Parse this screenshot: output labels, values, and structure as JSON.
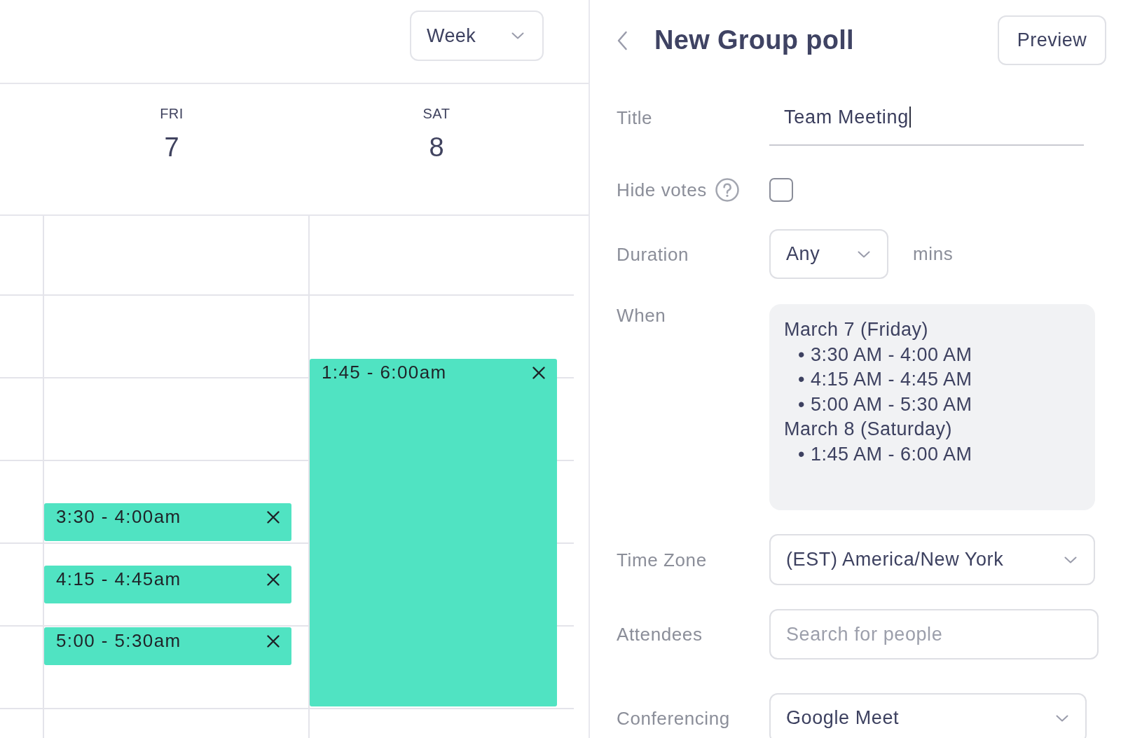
{
  "calendar": {
    "view_select": {
      "value": "Week"
    },
    "days": [
      {
        "weekday": "FRI",
        "date": "7",
        "events": [
          {
            "label": "3:30 - 4:00am"
          },
          {
            "label": "4:15 - 4:45am"
          },
          {
            "label": "5:00 - 5:30am"
          }
        ]
      },
      {
        "weekday": "SAT",
        "date": "8",
        "events": [
          {
            "label": "1:45 - 6:00am"
          }
        ]
      }
    ]
  },
  "poll_panel": {
    "title": "New Group poll",
    "preview_button": "Preview",
    "fields": [
      {
        "kind": "text",
        "label": "Title",
        "value": "Team Meeting",
        "focused": true
      },
      {
        "kind": "checkbox",
        "label": "Hide votes",
        "checked": false
      },
      {
        "kind": "select",
        "label": "Duration",
        "value": "Any",
        "suffix": "mins"
      },
      {
        "kind": "summary",
        "label": "When",
        "groups": [
          {
            "heading": "March 7 (Friday)",
            "items": [
              "• 3:30 AM - 4:00 AM",
              "• 4:15 AM - 4:45 AM",
              "• 5:00 AM - 5:30 AM"
            ]
          },
          {
            "heading": "March 8 (Saturday)",
            "items": [
              "• 1:45 AM - 6:00 AM"
            ]
          }
        ]
      },
      {
        "kind": "select",
        "label": "Time Zone",
        "value": "(EST) America/New York"
      },
      {
        "kind": "search",
        "label": "Attendees",
        "placeholder": "Search for people"
      },
      {
        "kind": "select",
        "label": "Conferencing",
        "value": "Google Meet"
      }
    ]
  }
}
